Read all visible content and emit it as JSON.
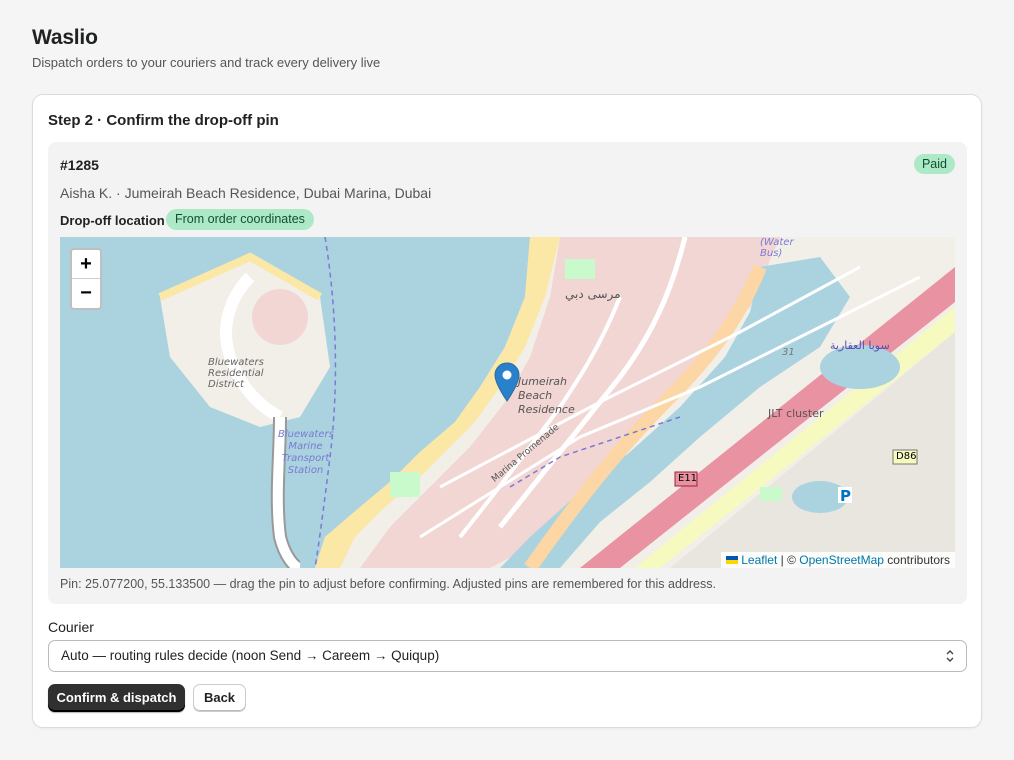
{
  "app": {
    "title": "Waslio",
    "subtitle": "Dispatch orders to your couriers and track every delivery live"
  },
  "step": {
    "title": "Step 2 · Confirm the drop-off pin"
  },
  "order": {
    "id": "#1285",
    "status": "Paid",
    "customer": "Aisha K. · Jumeirah Beach Residence, Dubai Marina, Dubai",
    "drop_label": "Drop-off location",
    "drop_source": "From order coordinates"
  },
  "map": {
    "zoom_in": "+",
    "zoom_out": "−",
    "attribution_leaflet": "Leaflet",
    "attribution_sep": " | © ",
    "attribution_osm": "OpenStreetMap",
    "attribution_tail": " contributors",
    "labels": {
      "bluewaters": "Bluewaters Residential District",
      "bluewaters_station": "Bluewaters Marine Transport Station",
      "jbr": "Jumeirah Beach Residence",
      "marsa_dubai_ar": "مرسى دبي",
      "water_bus": "(Water Bus)",
      "jlt": "JLT cluster",
      "sobha": "سوبا العقارية",
      "route_e11": "E11",
      "route_d86": "D86",
      "route_31": "31",
      "promenade": "Marina Promenade",
      "parking": "P"
    },
    "pin": {
      "lat": 25.0772,
      "lng": 55.1335
    }
  },
  "pin_note": "Pin: 25.077200, 55.133500 — drag the pin to adjust before confirming. Adjusted pins are remembered for this address.",
  "courier": {
    "label": "Courier",
    "selected": "Auto — routing rules decide (noon Send → Careem → Quiqup)"
  },
  "actions": {
    "confirm": "Confirm & dispatch",
    "back": "Back"
  },
  "colors": {
    "badge_bg": "#aee9c7",
    "badge_text": "#0c5132",
    "primary_btn": "#303030",
    "link": "#0078a8",
    "water": "#aad3df"
  }
}
